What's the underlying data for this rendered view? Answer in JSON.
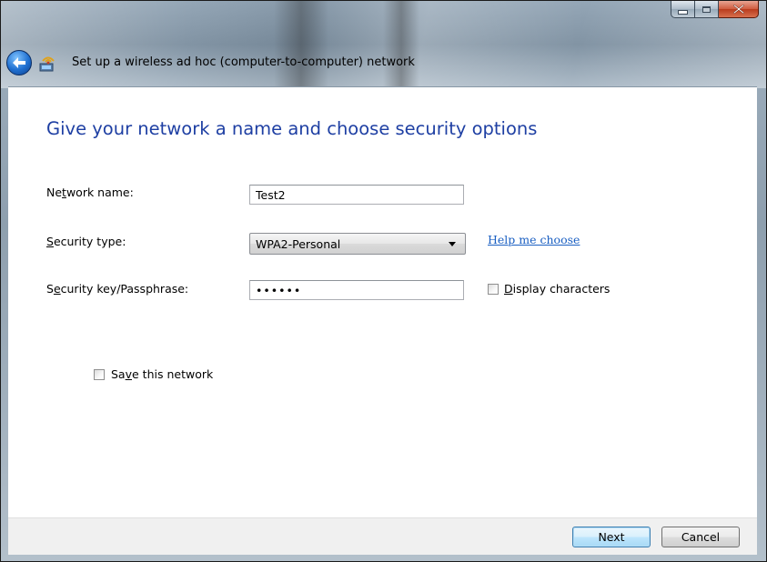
{
  "window": {
    "title": "Set up a wireless ad hoc (computer-to-computer) network",
    "caption_buttons": {
      "minimize": "minimize-icon",
      "maximize": "maximize-icon",
      "close": "close-icon"
    }
  },
  "page": {
    "heading": "Give your network a name and choose security options"
  },
  "form": {
    "network_name": {
      "label_pre": "Ne",
      "label_key": "t",
      "label_post": "work name:",
      "value": "Test2"
    },
    "security_type": {
      "label_pre": "",
      "label_key": "S",
      "label_post": "ecurity type:",
      "value": "WPA2-Personal"
    },
    "security_key": {
      "label_pre": "S",
      "label_key": "e",
      "label_post": "curity key/Passphrase:",
      "value": "••••••"
    },
    "help_link": "Help me choose",
    "display_characters": {
      "label_pre": "",
      "label_key": "D",
      "label_post": "isplay characters",
      "checked": false
    },
    "save_network": {
      "label_pre": "Sa",
      "label_key": "v",
      "label_post": "e this network",
      "checked": false
    }
  },
  "footer": {
    "next_label": "Next",
    "cancel_label": "Cancel"
  },
  "colors": {
    "heading": "#1e3fa3",
    "link": "#1a5fc2",
    "close_button": "#c44a2c"
  }
}
